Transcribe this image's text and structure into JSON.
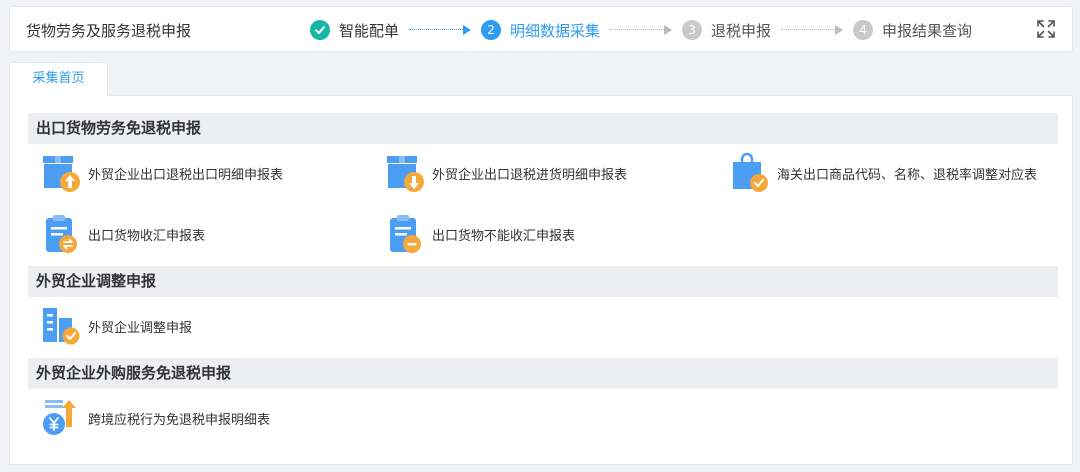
{
  "header": {
    "title": "货物劳务及服务退税申报",
    "steps": [
      {
        "num": "",
        "label": "智能配单"
      },
      {
        "num": "2",
        "label": "明细数据采集"
      },
      {
        "num": "3",
        "label": "退税申报"
      },
      {
        "num": "4",
        "label": "申报结果查询"
      }
    ]
  },
  "tabs": [
    {
      "label": "采集首页"
    }
  ],
  "sections": [
    {
      "title": "出口货物劳务免退税申报",
      "items": [
        {
          "label": "外贸企业出口退税出口明细申报表",
          "icon": "box-upload-icon"
        },
        {
          "label": "外贸企业出口退税进货明细申报表",
          "icon": "box-download-icon"
        },
        {
          "label": "海关出口商品代码、名称、退税率调整对应表",
          "icon": "shopping-bag-check-icon"
        },
        {
          "label": "出口货物收汇申报表",
          "icon": "clipboard-exchange-icon"
        },
        {
          "label": "出口货物不能收汇申报表",
          "icon": "clipboard-minus-icon"
        }
      ]
    },
    {
      "title": "外贸企业调整申报",
      "items": [
        {
          "label": "外贸企业调整申报",
          "icon": "building-check-icon"
        }
      ]
    },
    {
      "title": "外贸企业外购服务免退税申报",
      "items": [
        {
          "label": "跨境应税行为免退税申报明细表",
          "icon": "yen-coin-upload-icon"
        }
      ]
    }
  ],
  "colors": {
    "accent": "#2e9cf2",
    "done": "#16b7a5",
    "todo": "#c9c9c9",
    "icon_blue": "#4c9ef5",
    "icon_orange": "#f5a93b"
  }
}
